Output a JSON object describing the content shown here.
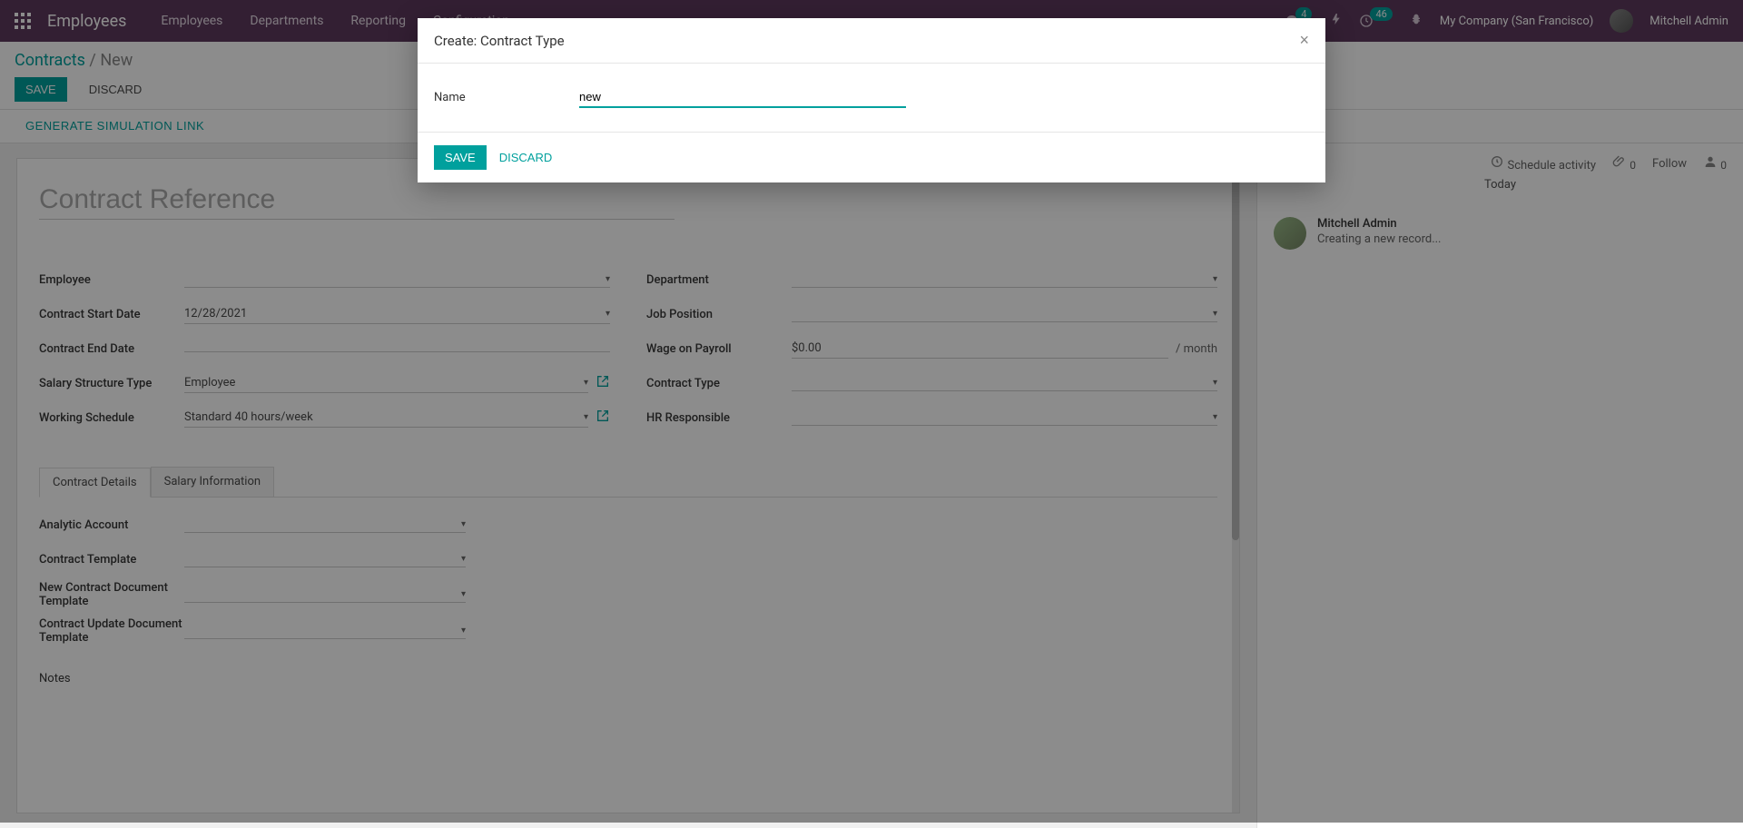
{
  "nav": {
    "app_title": "Employees",
    "items": [
      "Employees",
      "Departments",
      "Reporting",
      "Configuration"
    ],
    "msg_badge": "4",
    "activity_badge": "46",
    "company": "My Company (San Francisco)",
    "user": "Mitchell Admin"
  },
  "breadcrumb": {
    "root": "Contracts",
    "sep": " / ",
    "leaf": "New"
  },
  "actions": {
    "save": "SAVE",
    "discard": "DISCARD"
  },
  "simbar": {
    "generate": "GENERATE SIMULATION LINK"
  },
  "msg_toolbar": {
    "schedule": "Schedule activity",
    "attach_count": "0",
    "follow": "Follow",
    "follower_count": "0",
    "today": "Today"
  },
  "form": {
    "ref_placeholder": "Contract Reference",
    "left": {
      "employee": {
        "label": "Employee",
        "value": ""
      },
      "start": {
        "label": "Contract Start Date",
        "value": "12/28/2021"
      },
      "end": {
        "label": "Contract End Date",
        "value": ""
      },
      "struct": {
        "label": "Salary Structure Type",
        "value": "Employee"
      },
      "sched": {
        "label": "Working Schedule",
        "value": "Standard 40 hours/week"
      }
    },
    "right": {
      "dept": {
        "label": "Department",
        "value": ""
      },
      "jobpos": {
        "label": "Job Position",
        "value": ""
      },
      "wage": {
        "label": "Wage on Payroll",
        "value": "$0.00",
        "suffix": "/ month"
      },
      "ctype": {
        "label": "Contract Type",
        "value": ""
      },
      "hr": {
        "label": "HR Responsible",
        "value": ""
      }
    },
    "tabs": {
      "details": "Contract Details",
      "salary": "Salary Information"
    },
    "details": {
      "analytic": {
        "label": "Analytic Account",
        "value": ""
      },
      "template": {
        "label": "Contract Template",
        "value": ""
      },
      "newdoc": {
        "label": "New Contract Document Template",
        "value": ""
      },
      "upddoc": {
        "label": "Contract Update Document Template",
        "value": ""
      },
      "notes_label": "Notes"
    }
  },
  "log": {
    "author": "Mitchell Admin",
    "text": "Creating a new record..."
  },
  "modal": {
    "title": "Create: Contract Type",
    "name_label": "Name",
    "name_value": "new",
    "save": "SAVE",
    "discard": "DISCARD"
  }
}
